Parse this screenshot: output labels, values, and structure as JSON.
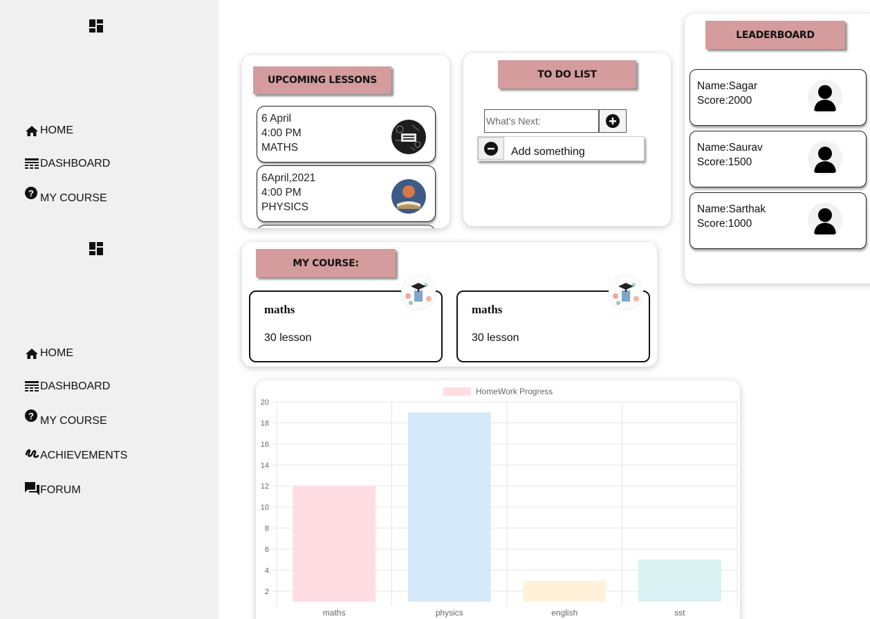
{
  "sidebar": {
    "menu1": [
      {
        "label": "HOME",
        "icon": "home-icon"
      },
      {
        "label": "DASHBOARD",
        "icon": "dashboard-icon"
      },
      {
        "label": "MY COURSE",
        "icon": "help-icon"
      }
    ],
    "menu2": [
      {
        "label": "HOME",
        "icon": "home-icon"
      },
      {
        "label": "DASHBOARD",
        "icon": "dashboard-icon"
      },
      {
        "label": "MY COURSE",
        "icon": "help-icon"
      },
      {
        "label": "ACHIEVEMENTS",
        "icon": "achievements-icon"
      },
      {
        "label": "FORUM",
        "icon": "forum-icon"
      }
    ]
  },
  "upcoming": {
    "title": "UPCOMING LESSONS",
    "lessons": [
      {
        "date": "6 April",
        "time": "4:00 PM",
        "subject": "MATHS"
      },
      {
        "date": "6April,2021",
        "time": "4:00 PM",
        "subject": "PHYSICS"
      }
    ]
  },
  "todo": {
    "title": "TO DO LIST",
    "placeholder": "What's Next:",
    "items": [
      "Add something"
    ]
  },
  "leaderboard": {
    "title": "LEADERBOARD",
    "entries": [
      {
        "name": "Name:Sagar",
        "score": "Score:2000"
      },
      {
        "name": "Name:Saurav",
        "score": "Score:1500"
      },
      {
        "name": "Name:Sarthak",
        "score": "Score:1000"
      }
    ]
  },
  "my_course": {
    "title": "MY COURSE:",
    "courses": [
      {
        "name": "maths",
        "lessons": "30 lesson"
      },
      {
        "name": "maths",
        "lessons": "30 lesson"
      }
    ]
  },
  "colors": {
    "accent_pill": "#d49c9c",
    "sidebar_bg": "#f0f0f0"
  },
  "chart_data": {
    "type": "bar",
    "categories": [
      "maths",
      "physics",
      "english",
      "sst"
    ],
    "series": [
      {
        "name": "HomeWork Progress",
        "values": [
          12,
          19,
          3,
          5
        ]
      }
    ],
    "bar_colors": [
      "#ffdde3",
      "#d6e9f8",
      "#fff2d8",
      "#d9f1f1"
    ],
    "ylim": [
      1,
      20
    ],
    "yticks": [
      2,
      4,
      6,
      8,
      10,
      12,
      14,
      16,
      18,
      20
    ],
    "grid": true,
    "legend": "top-center"
  }
}
